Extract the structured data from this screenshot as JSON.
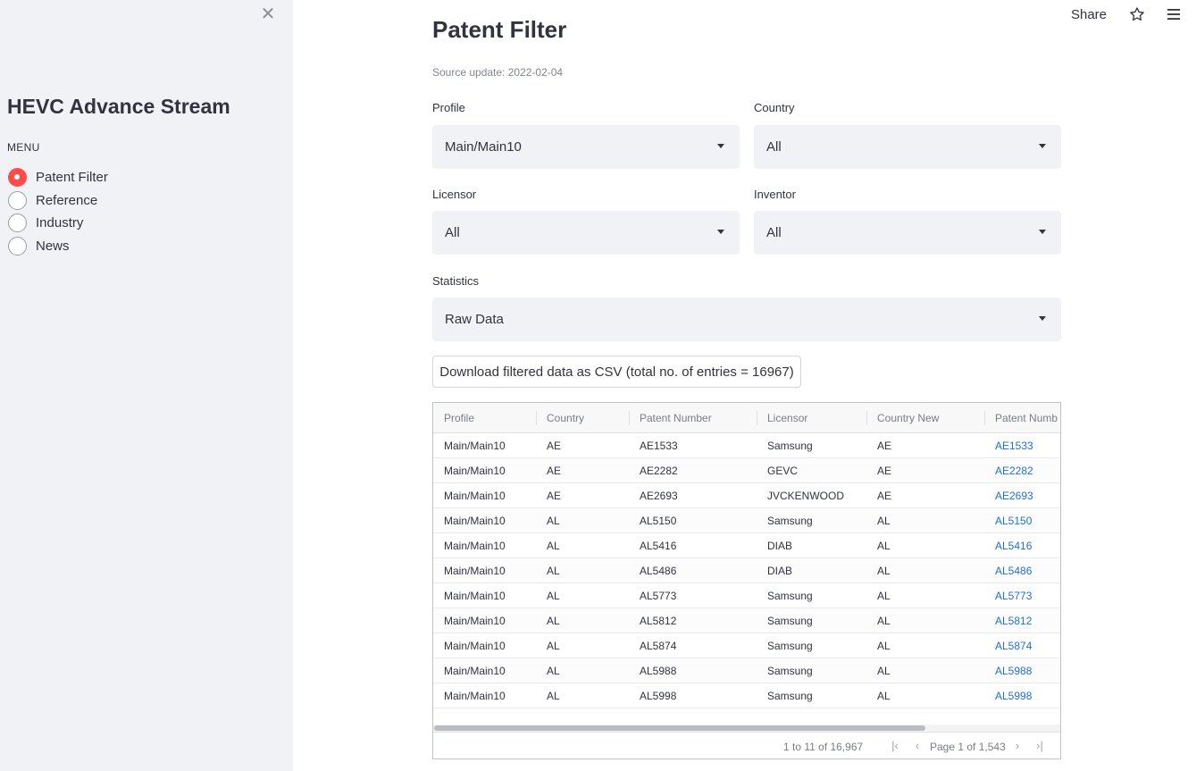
{
  "sidebar": {
    "title": "HEVC Advance Stream",
    "menu_label": "MENU",
    "items": [
      {
        "label": "Patent Filter",
        "checked": true
      },
      {
        "label": "Reference",
        "checked": false
      },
      {
        "label": "Industry",
        "checked": false
      },
      {
        "label": "News",
        "checked": false
      }
    ]
  },
  "toolbar": {
    "share_label": "Share",
    "icons": [
      "star-icon",
      "hamburger-menu-icon"
    ]
  },
  "main": {
    "title": "Patent Filter",
    "source_update": "Source update: 2022-02-04",
    "filters": {
      "profile": {
        "label": "Profile",
        "value": "Main/Main10"
      },
      "country": {
        "label": "Country",
        "value": "All"
      },
      "licensor": {
        "label": "Licensor",
        "value": "All"
      },
      "inventor": {
        "label": "Inventor",
        "value": "All"
      },
      "statistics": {
        "label": "Statistics",
        "value": "Raw Data"
      }
    },
    "download_label": "Download filtered data as CSV (total no. of entries = 16967)"
  },
  "grid": {
    "columns": [
      "Profile",
      "Country",
      "Patent Number",
      "Licensor",
      "Country New",
      "Patent Numb"
    ],
    "rows": [
      [
        "Main/Main10",
        "AE",
        "AE1533",
        "Samsung",
        "AE",
        "AE1533"
      ],
      [
        "Main/Main10",
        "AE",
        "AE2282",
        "GEVC",
        "AE",
        "AE2282"
      ],
      [
        "Main/Main10",
        "AE",
        "AE2693",
        "JVCKENWOOD",
        "AE",
        "AE2693"
      ],
      [
        "Main/Main10",
        "AL",
        "AL5150",
        "Samsung",
        "AL",
        "AL5150"
      ],
      [
        "Main/Main10",
        "AL",
        "AL5416",
        "DIAB",
        "AL",
        "AL5416"
      ],
      [
        "Main/Main10",
        "AL",
        "AL5486",
        "DIAB",
        "AL",
        "AL5486"
      ],
      [
        "Main/Main10",
        "AL",
        "AL5773",
        "Samsung",
        "AL",
        "AL5773"
      ],
      [
        "Main/Main10",
        "AL",
        "AL5812",
        "Samsung",
        "AL",
        "AL5812"
      ],
      [
        "Main/Main10",
        "AL",
        "AL5874",
        "Samsung",
        "AL",
        "AL5874"
      ],
      [
        "Main/Main10",
        "AL",
        "AL5988",
        "Samsung",
        "AL",
        "AL5988"
      ],
      [
        "Main/Main10",
        "AL",
        "AL5998",
        "Samsung",
        "AL",
        "AL5998"
      ]
    ],
    "footer": {
      "row_summary": "1 to 11 of 16,967",
      "page_info": "Page 1 of 1,543",
      "pager_icons": [
        "first-page-icon",
        "prev-page-icon",
        "next-page-icon",
        "last-page-icon"
      ]
    }
  },
  "colors": {
    "accent": "#ff4b4b",
    "sidebar_bg": "#f0f2f6",
    "link": "#1e6fd9"
  }
}
